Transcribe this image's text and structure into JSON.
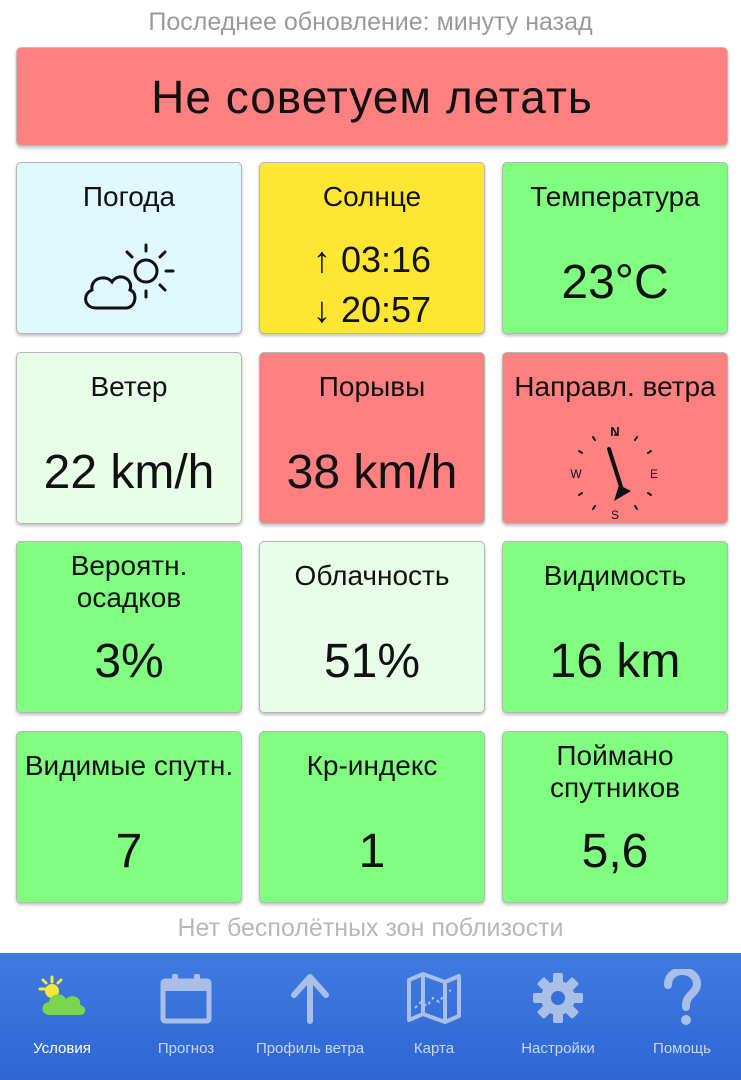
{
  "header": {
    "last_update": "Последнее обновление: минуту назад"
  },
  "status": {
    "text": "Не советуем летать",
    "color": "#ff8080"
  },
  "tiles": {
    "weather": {
      "label": "Погода",
      "icon": "partly-cloudy-icon",
      "color": "#e0f8ff"
    },
    "sun": {
      "label": "Солнце",
      "sunrise_arrow": "↑",
      "sunrise": "03:16",
      "sunset_arrow": "↓",
      "sunset": "20:57",
      "color": "#ffe633"
    },
    "temperature": {
      "label": "Температура",
      "value": "23°C",
      "color": "#80ff80"
    },
    "wind": {
      "label": "Ветер",
      "value": "22 km/h",
      "color": "#e6ffe6"
    },
    "gusts": {
      "label": "Порывы",
      "value": "38 km/h",
      "color": "#ff8080"
    },
    "wind_dir": {
      "label": "Направл. ветра",
      "n": "N",
      "e": "E",
      "s": "S",
      "w": "W",
      "icon": "compass-icon",
      "color": "#ff8080"
    },
    "precip": {
      "label_line1": "Вероятн.",
      "label_line2": "осадков",
      "value": "3%",
      "color": "#80ff80"
    },
    "cloud": {
      "label": "Облачность",
      "value": "51%",
      "color": "#e6ffe6"
    },
    "visibility": {
      "label": "Видимость",
      "value": "16 km",
      "color": "#80ff80"
    },
    "sats_visible": {
      "label": "Видимые спутн.",
      "value": "7",
      "color": "#80ff80"
    },
    "kp": {
      "label": "Кр-индекс",
      "value": "1",
      "color": "#80ff80"
    },
    "sats_locked": {
      "label_line1": "Поймано",
      "label_line2": "спутников",
      "value": "5,6",
      "color": "#80ff80"
    }
  },
  "footer_note": "Нет бесполётных зон поблизости",
  "nav": {
    "items": [
      {
        "label": "Условия",
        "icon": "weather-icon",
        "active": true
      },
      {
        "label": "Прогноз",
        "icon": "calendar-icon"
      },
      {
        "label": "Профиль ветра",
        "icon": "arrow-up-icon"
      },
      {
        "label": "Карта",
        "icon": "map-icon"
      },
      {
        "label": "Настройки",
        "icon": "gear-icon"
      },
      {
        "label": "Помощь",
        "icon": "question-icon"
      }
    ]
  }
}
